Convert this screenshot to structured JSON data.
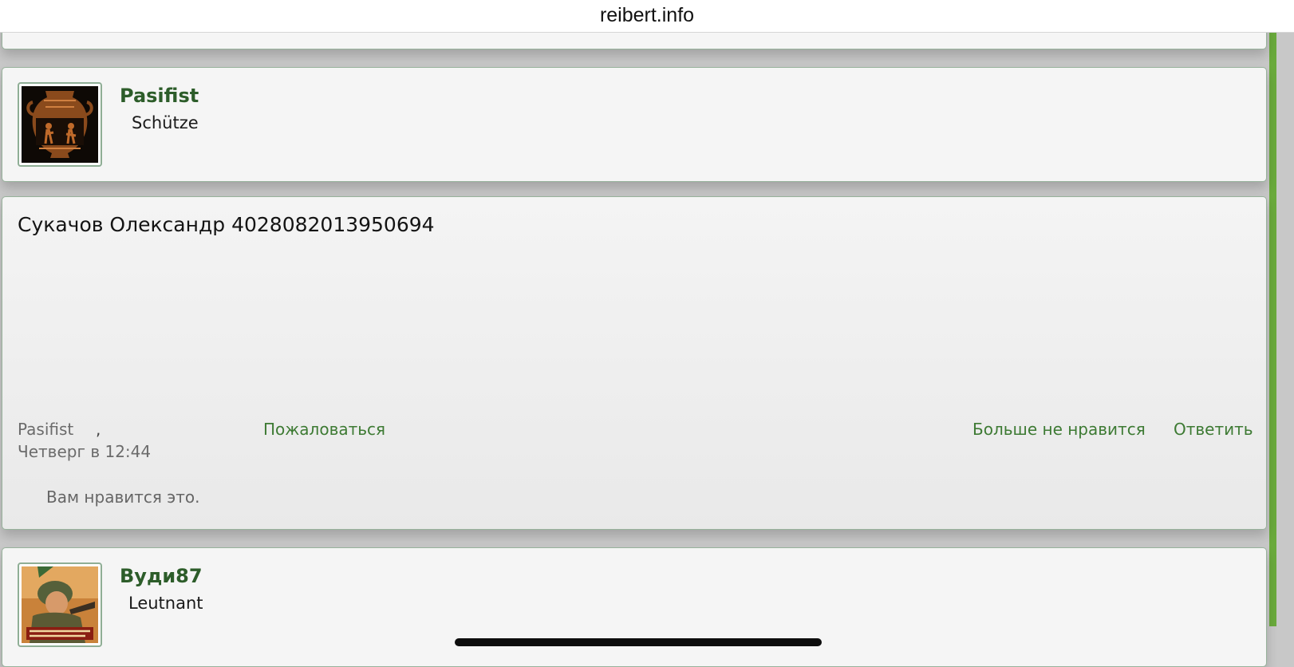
{
  "browser": {
    "url": "reibert.info"
  },
  "posts": {
    "user1": {
      "username": "Pasifist",
      "rank": "Schütze"
    },
    "message": {
      "text": "Сукачов Олександр 4028082013950694",
      "author": "Pasifist",
      "comma": ",",
      "date": "Четверг в 12:44",
      "report_label": "Пожаловаться",
      "unlike_label": "Больше не нравится",
      "reply_label": "Ответить",
      "likes_summary": "Вам нравится это."
    },
    "user2": {
      "username": "Вуди87",
      "rank": "Leutnant"
    }
  },
  "colors": {
    "accent_green": "#3d7a33",
    "username_green": "#2d5d2a",
    "scroll_accent": "#6aaa3c"
  },
  "icons": {
    "avatar1": "greek-vase-avatar",
    "avatar2": "soldier-poster-avatar"
  }
}
